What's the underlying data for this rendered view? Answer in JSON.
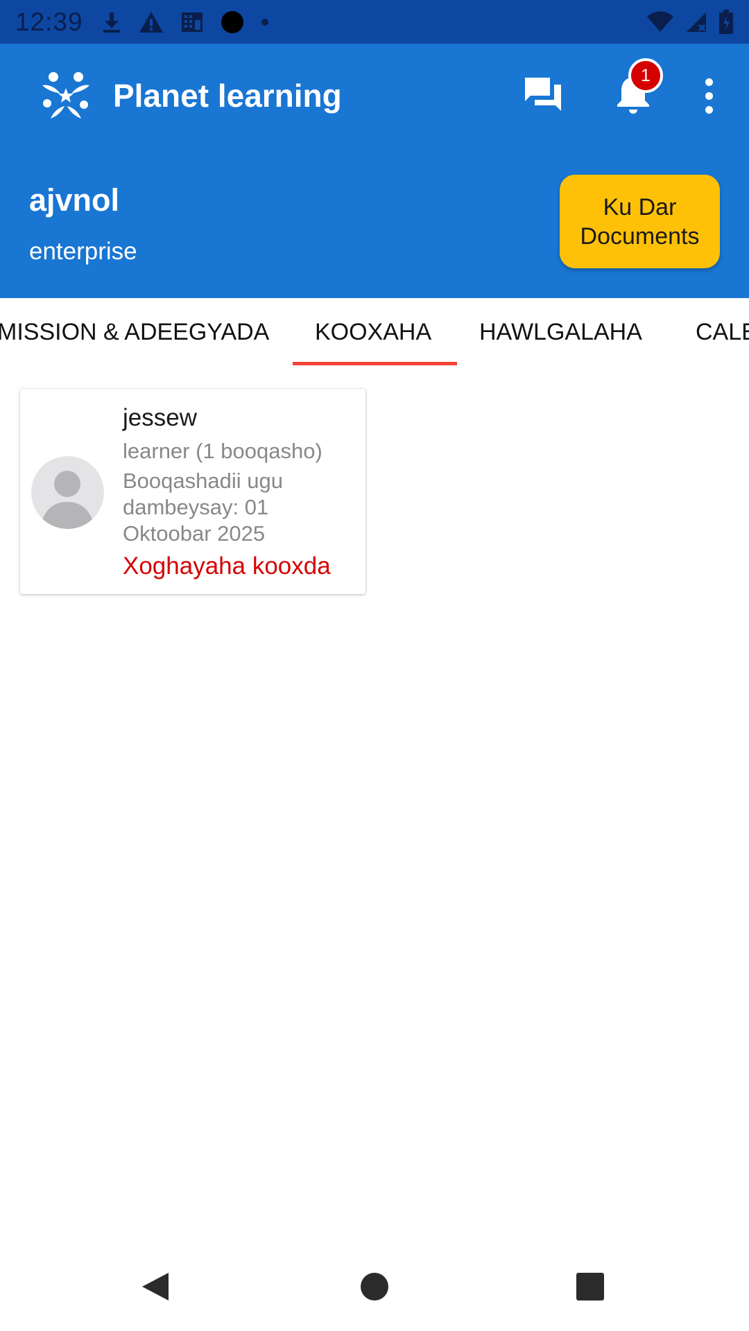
{
  "status_bar": {
    "time": "12:39",
    "icons": [
      "download-icon",
      "warning-icon",
      "building-icon",
      "circle-icon",
      "dot-icon",
      "wifi-icon",
      "cell-signal-icon",
      "battery-icon"
    ]
  },
  "app_bar": {
    "title": "Planet learning",
    "notification_count": "1",
    "icons": [
      "planet-logo-icon",
      "chat-icon",
      "bell-icon",
      "more-vert-icon"
    ]
  },
  "header": {
    "team_name": "ajvnol",
    "team_type": "enterprise",
    "add_documents_label": "Ku Dar Documents"
  },
  "tabs": [
    {
      "label": "MISSION & ADEEGYADA",
      "active": false
    },
    {
      "label": "KOOXAHA",
      "active": true
    },
    {
      "label": "HAWLGALAHA",
      "active": false
    },
    {
      "label": "CALE",
      "active": false
    }
  ],
  "members": [
    {
      "name": "jessew",
      "role": "learner (1 booqasho)",
      "last_visit": "Booqashadii ugu dambeysay: 01 Oktoobar 2025",
      "action": "Xoghayaha kooxda"
    }
  ],
  "colors": {
    "status_bar": "#0d47a1",
    "primary": "#1976d2",
    "accent_button": "#ffc107",
    "tab_indicator": "#f44336",
    "action_text": "#d50000"
  },
  "nav_bar": {
    "icons": [
      "back-icon",
      "home-icon",
      "recents-icon"
    ]
  }
}
